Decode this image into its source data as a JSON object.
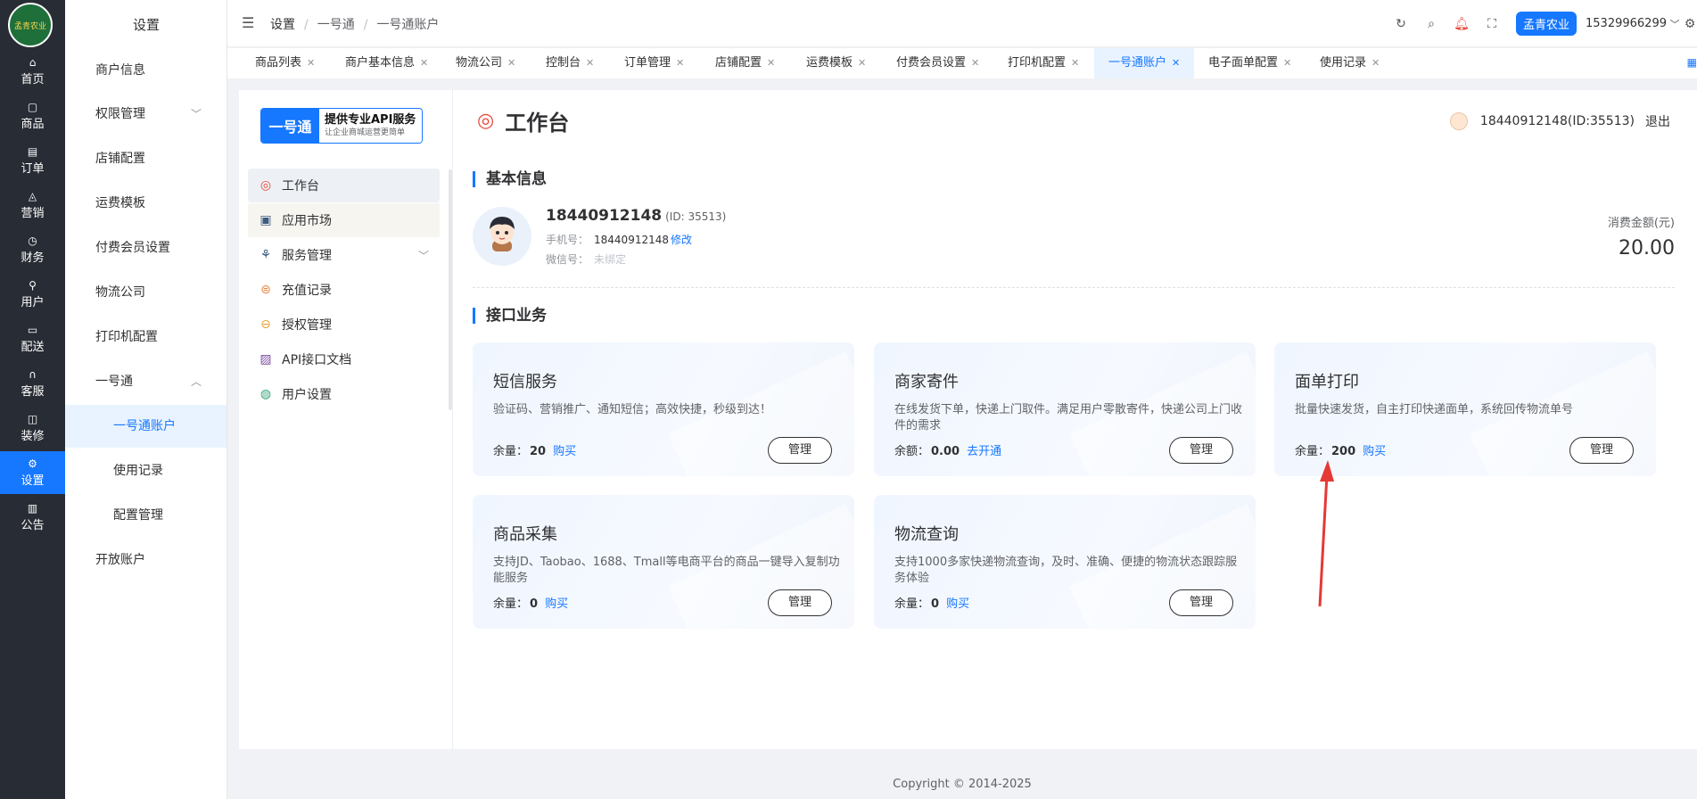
{
  "rail": {
    "logo_text": "孟青农业",
    "items": [
      {
        "label": "首页",
        "icon": "home-icon",
        "glyph": "⌂"
      },
      {
        "label": "商品",
        "icon": "bag-icon",
        "glyph": "▢"
      },
      {
        "label": "订单",
        "icon": "order-icon",
        "glyph": "▤"
      },
      {
        "label": "营销",
        "icon": "bell-icon",
        "glyph": "◬"
      },
      {
        "label": "财务",
        "icon": "clock-icon",
        "glyph": "◷"
      },
      {
        "label": "用户",
        "icon": "user-icon",
        "glyph": "⚲"
      },
      {
        "label": "配送",
        "icon": "truck-icon",
        "glyph": "▭"
      },
      {
        "label": "客服",
        "icon": "headset-icon",
        "glyph": "∩"
      },
      {
        "label": "装修",
        "icon": "brush-icon",
        "glyph": "◫"
      },
      {
        "label": "设置",
        "icon": "gear-icon",
        "glyph": "⚙"
      },
      {
        "label": "公告",
        "icon": "notice-icon",
        "glyph": "▥"
      }
    ]
  },
  "submenu": {
    "title": "设置",
    "items": [
      "商户信息",
      "权限管理",
      "店铺配置",
      "运费模板",
      "付费会员设置",
      "物流公司",
      "打印机配置",
      "一号通",
      "一号通账户",
      "使用记录",
      "配置管理",
      "开放账户"
    ]
  },
  "header": {
    "breadcrumb": [
      "设置",
      "一号通",
      "一号通账户"
    ],
    "shop_name": "孟青农业",
    "phone": "15329966299"
  },
  "tabs": [
    "商品列表",
    "商户基本信息",
    "物流公司",
    "控制台",
    "订单管理",
    "店铺配置",
    "运费模板",
    "付费会员设置",
    "打印机配置",
    "一号通账户",
    "电子面单配置",
    "使用记录"
  ],
  "brand": {
    "badge": "一号通",
    "line1": "提供专业API服务",
    "line2": "让企业商城运营更简单"
  },
  "left_nav": [
    "工作台",
    "应用市场",
    "服务管理",
    "充值记录",
    "授权管理",
    "API接口文档",
    "用户设置"
  ],
  "workbench": {
    "title": "工作台",
    "account": "18440912148(ID:35513)",
    "logout": "退出"
  },
  "basic": {
    "section_title": "基本信息",
    "username": "18440912148",
    "id_text": "(ID: 35513)",
    "phone_label": "手机号：",
    "phone_value": "18440912148",
    "modify": "修改",
    "wechat_label": "微信号：",
    "wechat_value": "未绑定",
    "spend_label": "消费金额(元)",
    "spend_value": "20.00"
  },
  "api": {
    "section_title": "接口业务",
    "manage_label": "管理",
    "cards": [
      {
        "title": "短信服务",
        "desc": "验证码、营销推广、通知短信；高效快捷，秒级到达！",
        "qty_label": "余量：",
        "qty": "20",
        "action": "购买"
      },
      {
        "title": "商家寄件",
        "desc": "在线发货下单，快递上门取件。满足用户零散寄件，快递公司上门收件的需求",
        "qty_label": "余额：",
        "qty": "0.00",
        "action": "去开通"
      },
      {
        "title": "面单打印",
        "desc": "批量快速发货，自主打印快递面单，系统回传物流单号",
        "qty_label": "余量：",
        "qty": "200",
        "action": "购买"
      },
      {
        "title": "商品采集",
        "desc": "支持JD、Taobao、1688、Tmall等电商平台的商品一键导入复制功能服务",
        "qty_label": "余量：",
        "qty": "0",
        "action": "购买"
      },
      {
        "title": "物流查询",
        "desc": "支持1000多家快递物流查询，及时、准确、便捷的物流状态跟踪服务体验",
        "qty_label": "余量：",
        "qty": "0",
        "action": "购买"
      }
    ]
  },
  "footer": {
    "copyright": "Copyright © 2014-2025"
  },
  "colors": {
    "accent": "#1677ff",
    "rail_bg": "#282c34",
    "annotation_arrow": "#e53935"
  }
}
